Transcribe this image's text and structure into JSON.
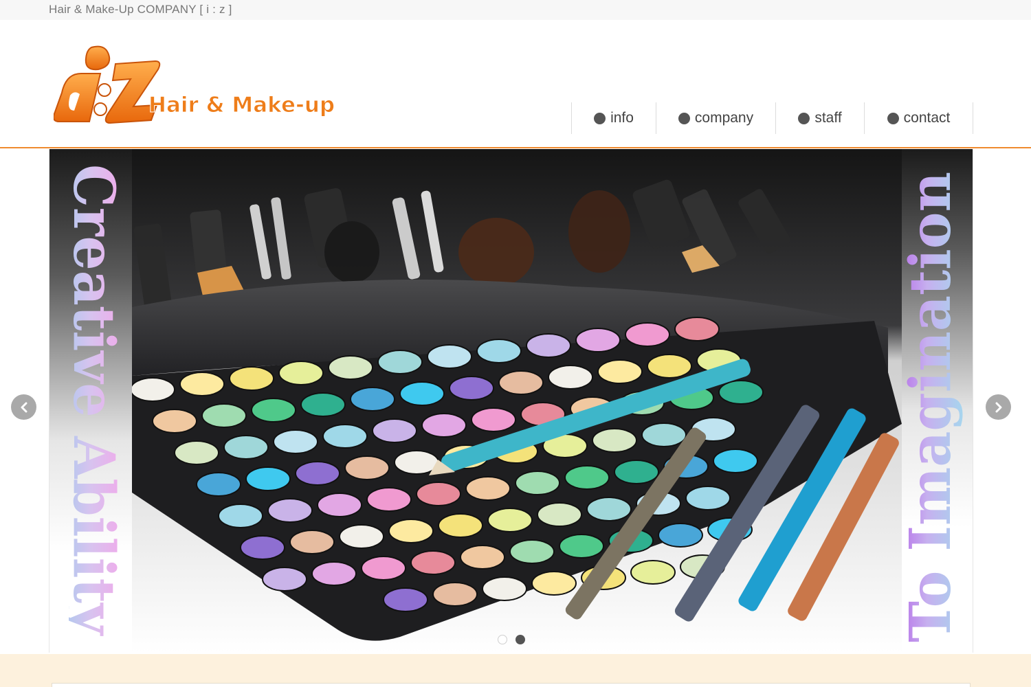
{
  "topbar": {
    "tagline": "Hair & Make-Up COMPANY [ i : z ]"
  },
  "logo": {
    "mark": "i:z",
    "text": "Hair & Make-up"
  },
  "nav": [
    {
      "label": "info"
    },
    {
      "label": "company"
    },
    {
      "label": "staff"
    },
    {
      "label": "contact"
    }
  ],
  "slider": {
    "left_caption": "Creative Ability",
    "right_caption": "To Imagination",
    "active_slide": 2,
    "slide_count": 2
  },
  "colors": {
    "brand_orange": "#ef8a2e",
    "nav_dot": "#555555",
    "footer_band": "#fdf1dd"
  },
  "icons": {
    "prev": "chevron-left-icon",
    "next": "chevron-right-icon"
  }
}
